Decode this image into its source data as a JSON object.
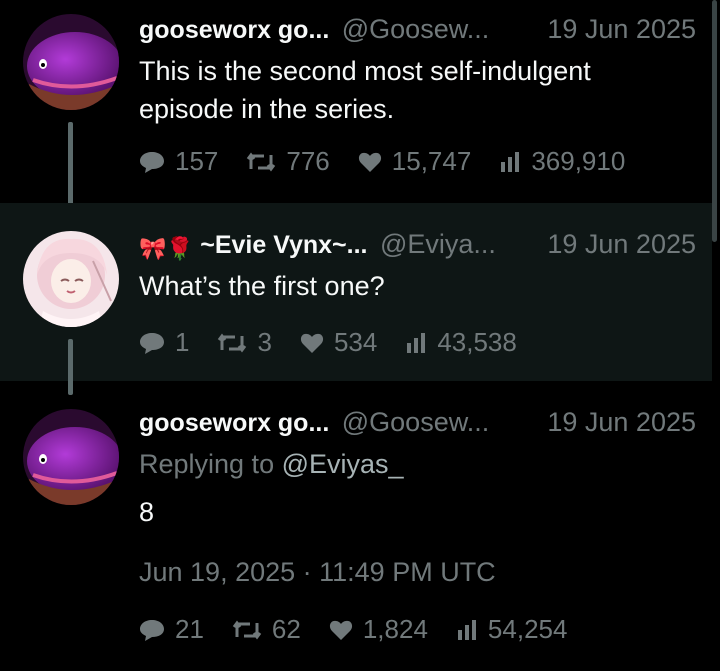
{
  "tweets": [
    {
      "name": "gooseworx go...",
      "handle": "@Goosew...",
      "date": "19 Jun 2025",
      "text_lines": [
        "This is the second most self-indulgent",
        "episode in the series."
      ],
      "replies": "157",
      "retweets": "776",
      "likes": "15,747",
      "views": "369,910"
    },
    {
      "emojis": "🎀🌹",
      "name": "~Evie Vynx~...",
      "handle": "@Eviya...",
      "date": "19 Jun 2025",
      "text": "What’s the first one?",
      "replies": "1",
      "retweets": "3",
      "likes": "534",
      "views": "43,538"
    },
    {
      "name": "gooseworx go...",
      "handle": "@Goosew...",
      "date": "19 Jun 2025",
      "reply_prefix": "Replying to ",
      "reply_mention": "@Eviyas_",
      "text": "8",
      "timestamp": "Jun 19, 2025 · 11:49 PM UTC",
      "replies": "21",
      "retweets": "62",
      "likes": "1,824",
      "views": "54,254"
    }
  ],
  "icons": {
    "reply": "reply-bubble-icon",
    "retweet": "retweet-icon",
    "like": "heart-icon",
    "views": "views-bar-icon"
  },
  "colors": {
    "background": "#000000",
    "highlight_row": "#0e1615",
    "text": "#f7f9f9",
    "muted": "#71797b",
    "thread_line": "#5b6a6b"
  }
}
